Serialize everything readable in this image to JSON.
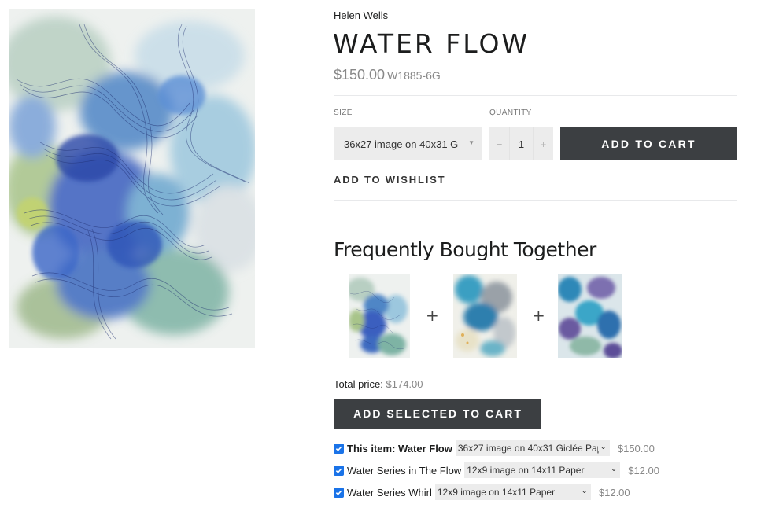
{
  "product": {
    "artist": "Helen Wells",
    "title": "WATER FLOW",
    "price": "$150.00",
    "sku": "W1885-6G",
    "size_label": "SIZE",
    "size_value": "36x27 image on 40x31 G",
    "quantity_label": "QUANTITY",
    "quantity_value": "1",
    "qty_minus": "−",
    "qty_plus": "+",
    "add_to_cart": "ADD TO CART",
    "add_to_wishlist": "ADD TO WISHLIST"
  },
  "fbt": {
    "heading": "Frequently Bought Together",
    "plus": "+",
    "total_label": "Total price:",
    "total_value": "$174.00",
    "add_selected": "ADD SELECTED TO CART",
    "items": [
      {
        "name": "This item: Water Flow",
        "option": "36x27 image on 40x31 Giclée Pap",
        "price": "$150.00",
        "checked": true
      },
      {
        "name": "Water Series in The Flow",
        "option": "12x9 image on 14x11 Paper",
        "price": "$12.00",
        "checked": true
      },
      {
        "name": "Water Series Whirl",
        "option": "12x9 image on 14x11 Paper",
        "price": "$12.00",
        "checked": true
      }
    ]
  },
  "icons": {
    "dropdown": "chevron-down-icon",
    "checkbox": "checkmark-icon"
  },
  "colors": {
    "button_bg": "#3c3f42",
    "checkbox_blue": "#1a73e8",
    "muted_price": "#888888"
  }
}
